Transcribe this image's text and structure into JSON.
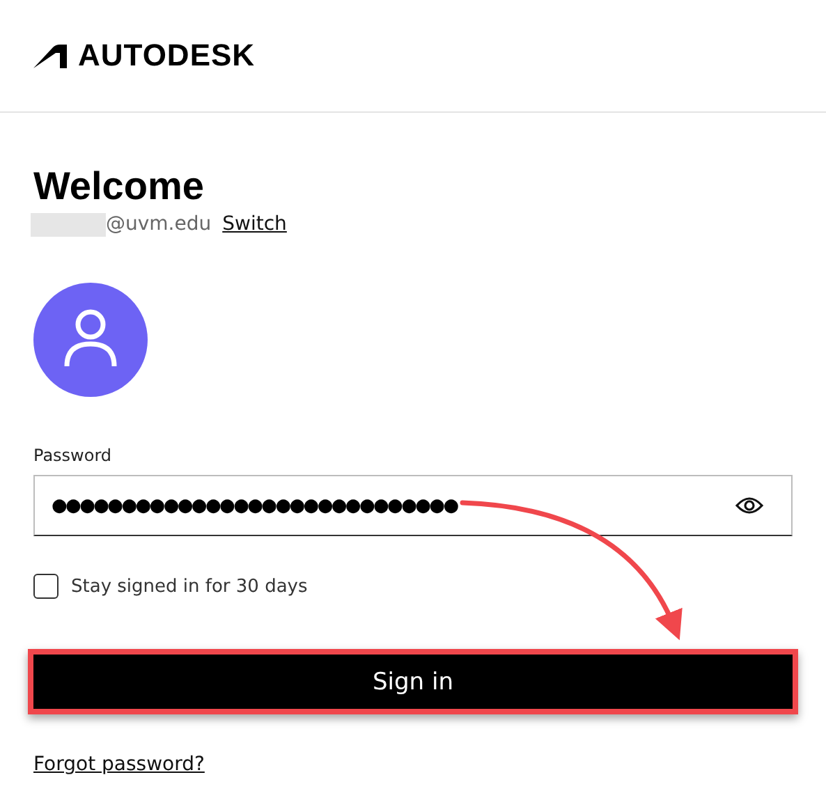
{
  "header": {
    "logo_text": "AUTODESK"
  },
  "title": "Welcome",
  "account": {
    "email_domain": "@uvm.edu",
    "switch_link": "Switch"
  },
  "password": {
    "label": "Password",
    "masked_value": "●●●●●●●●●●●●●●●●●●●●●●●●●●●●●"
  },
  "stay_signed_in": {
    "label": "Stay signed in for 30 days",
    "checked": false
  },
  "sign_in_button": {
    "label": "Sign in",
    "highlighted": true
  },
  "forgot_link": "Forgot password?"
}
